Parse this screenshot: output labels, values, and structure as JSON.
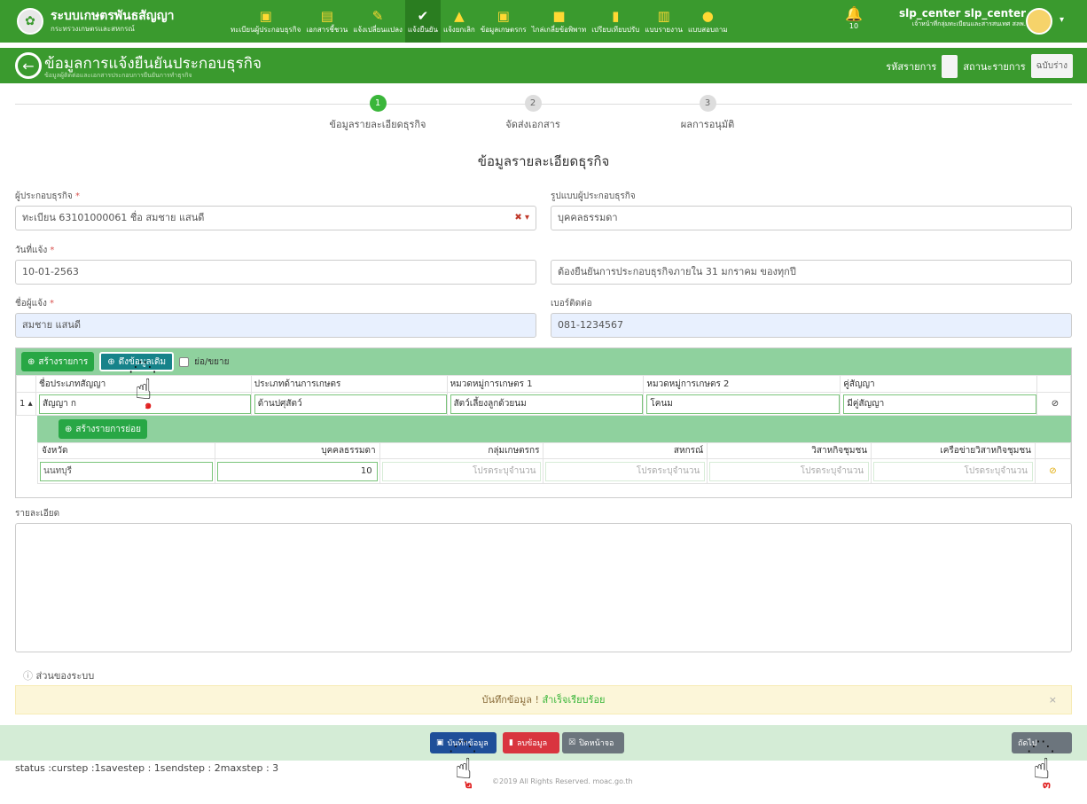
{
  "header": {
    "app_title": "ระบบเกษตรพันธสัญญา",
    "app_subtitle": "กระทรวงเกษตรและสหกรณ์",
    "menu": [
      {
        "label": "ทะเบียนผู้ประกอบธุรกิจ",
        "icon": "id-card-icon"
      },
      {
        "label": "เอกสารชี้ชวน",
        "icon": "clipboard-icon"
      },
      {
        "label": "แจ้งเปลี่ยนแปลง",
        "icon": "edit-icon"
      },
      {
        "label": "แจ้งยืนยัน",
        "icon": "check-circle-icon"
      },
      {
        "label": "แจ้งยกเลิก",
        "icon": "warning-icon"
      },
      {
        "label": "ข้อมูลเกษตรกร",
        "icon": "id-card-icon"
      },
      {
        "label": "ไกล่เกลี่ยข้อพิพาท",
        "icon": "comment-icon"
      },
      {
        "label": "เปรียบเทียบปรับ",
        "icon": "document-icon"
      },
      {
        "label": "แบบรายงาน",
        "icon": "bar-chart-icon"
      },
      {
        "label": "แบบสอบถาม",
        "icon": "chat-icon"
      }
    ],
    "notifications": "10",
    "user_name": "slp_center slp_center",
    "user_role": "เจ้าหน้าที่กลุ่มทะเบียนและสารสนเทศ สลพ."
  },
  "page": {
    "title": "ข้อมูลการแจ้งยืนยันประกอบธุรกิจ",
    "subtitle": "ข้อมูลผู้ติดต่อและเอกสารประกอบการยืนยันการทำธุรกิจ",
    "record_code_label": "รหัสรายการ",
    "record_status_label": "สถานะรายการ",
    "record_status_value": "ฉบับร่าง"
  },
  "steps": [
    {
      "num": "1",
      "label": "ข้อมูลรายละเอียดธุรกิจ"
    },
    {
      "num": "2",
      "label": "จัดส่งเอกสาร"
    },
    {
      "num": "3",
      "label": "ผลการอนุมัติ"
    }
  ],
  "form": {
    "section_title": "ข้อมูลรายละเอียดธุรกิจ",
    "operator_label": "ผู้ประกอบธุรกิจ",
    "operator_value": "ทะเบียน 63101000061 ชื่อ สมชาย แสนดี",
    "operator_type_label": "รูปแบบผู้ประกอบธุรกิจ",
    "operator_type_value": "บุคคลธรรมดา",
    "notify_date_label": "วันที่แจ้ง",
    "notify_date_value": "10-01-2563",
    "notice_value": "ต้องยืนยันการประกอบธุรกิจภายใน 31 มกราคม ของทุกปี",
    "notifier_label": "ชื่อผู้แจ้ง",
    "notifier_value": "สมชาย แสนดี",
    "phone_label": "เบอร์ติดต่อ",
    "phone_value": "081-1234567",
    "required_mark": "*"
  },
  "grid": {
    "create_label": "สร้างรายการ",
    "pull_label": "ดึงข้อมูลเดิม",
    "collapse_label": "ย่อ/ขยาย",
    "columns": [
      "ชื่อประเภทสัญญา",
      "ประเภทด้านการเกษตร",
      "หมวดหมู่การเกษตร 1",
      "หมวดหมู่การเกษตร 2",
      "คู่สัญญา"
    ],
    "row": {
      "index": "1",
      "toggle": "▴",
      "values": [
        "สัญญา ก",
        "ด้านปศุสัตว์",
        "สัตว์เลี้ยงลูกด้วยนม",
        "โคนม",
        "มีคู่สัญญา"
      ]
    },
    "sub_create_label": "สร้างรายการย่อย",
    "sub_columns": [
      "จังหวัด",
      "บุคคลธรรมดา",
      "กลุ่มเกษตรกร",
      "สหกรณ์",
      "วิสาหกิจชุมชน",
      "เครือข่ายวิสาหกิจชุมชน"
    ],
    "sub_row": {
      "province": "นนทบุรี",
      "values": [
        "10",
        "โปรดระบุจำนวน",
        "โปรดระบุจำนวน",
        "โปรดระบุจำนวน",
        "โปรดระบุจำนวน"
      ]
    }
  },
  "detail_label": "รายละเอียด",
  "system_label": "ส่วนของระบบ",
  "alert": {
    "prefix": "บันทึกข้อมูล !",
    "message": "สำเร็จเรียบร้อย",
    "close": "×"
  },
  "footer": {
    "save": "บันทึกข้อมูล",
    "delete": "ลบข้อมูล",
    "close": "ปิดหน้าจอ",
    "next": "ถัดไป",
    "status": "status :curstep :1savestep : 1sendstep : 2maxstep : 3",
    "copyright": "©2019 All Rights Reserved. moac.go.th"
  },
  "markers": [
    "๑",
    "๒",
    "๓"
  ]
}
